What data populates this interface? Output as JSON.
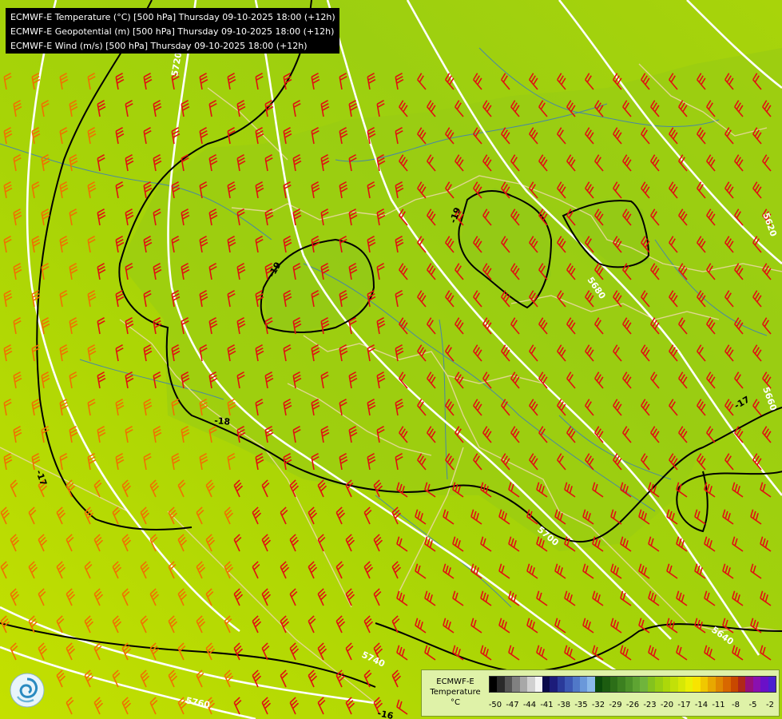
{
  "title_lines": [
    "ECMWF-E Temperature (°C) [500 hPa] Thursday 09-10-2025 18:00 (+12h)",
    "ECMWF-E Geopotential (m) [500 hPa] Thursday 09-10-2025 18:00 (+12h)",
    "ECMWF-E Wind (m/s) [500 hPa] Thursday 09-10-2025 18:00 (+12h)"
  ],
  "legend": {
    "line1": "ECMWF-E",
    "line2": "Temperature",
    "line3": "°C",
    "ticks": [
      "-50",
      "-47",
      "-44",
      "-41",
      "-38",
      "-35",
      "-32",
      "-29",
      "-26",
      "-23",
      "-20",
      "-17",
      "-14",
      "-11",
      "-8",
      "-5",
      "-2"
    ],
    "colors": [
      "#000000",
      "#2a2a2a",
      "#555555",
      "#808080",
      "#a8a8a8",
      "#d0d0d0",
      "#f4f4f4",
      "#0a0a4a",
      "#1c1c7a",
      "#2a3a9a",
      "#3c58b4",
      "#5078c8",
      "#6a98da",
      "#8ab8ea",
      "#0a4a0a",
      "#1c5c10",
      "#2c6e18",
      "#3c8020",
      "#4c9228",
      "#5ea432",
      "#70b43c",
      "#84c21e",
      "#98ce12",
      "#acd80a",
      "#c2e008",
      "#d6e806",
      "#eaf004",
      "#f8e400",
      "#f0c800",
      "#e8a800",
      "#e08800",
      "#d86800",
      "#c84800",
      "#b02818",
      "#98107a",
      "#8a10b0",
      "#6a10c8",
      "#4a20d0"
    ]
  },
  "contours": {
    "geopotential": [
      "5720",
      "5720",
      "5680",
      "5680",
      "5700",
      "5740",
      "5760",
      "5620",
      "5660",
      "5640"
    ],
    "temperature": [
      "-19",
      "-19",
      "-18",
      "-17",
      "-18",
      "-16",
      "-17"
    ]
  },
  "colors": {
    "field_warm": "#aed600",
    "field_mid": "#9acc10",
    "field_cold": "#84c21e",
    "wind_barb": "#e01010",
    "wind_barb_strong": "#f07000",
    "isohypse": "#ffffff",
    "isotherm": "#000000",
    "border": "#e8d8a0",
    "river": "#3a7ac0"
  },
  "icons": {
    "logo": "ecmwf-swirl-icon"
  }
}
